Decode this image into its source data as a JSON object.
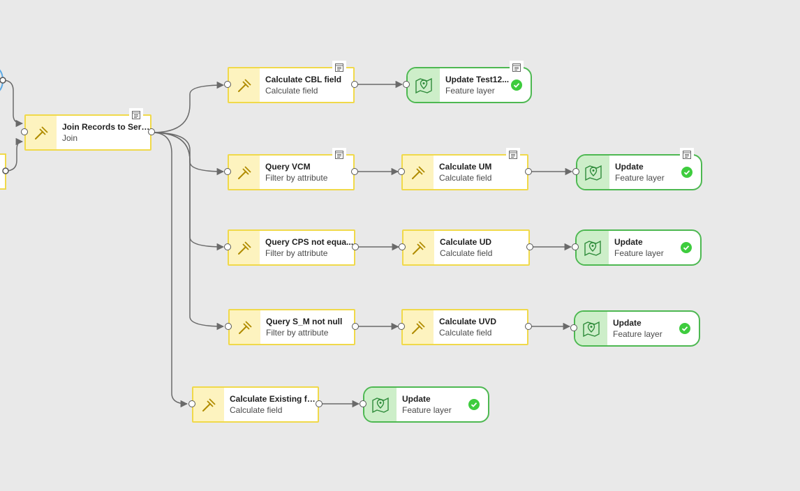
{
  "canvas": {
    "background": "#e9e9e9",
    "edge_color": "#6a6a6a"
  },
  "colors": {
    "tool_border": "#f0d94a",
    "tool_icon_bg": "#fdf3bf",
    "output_border": "#4db851",
    "output_icon_bg": "#cdeec9",
    "success": "#3ecc3e"
  },
  "nodes": {
    "join": {
      "title": "Join Records to Servi...",
      "subtitle": "Join",
      "icon": "hammer-icon",
      "has_note": true
    },
    "calc_cbl": {
      "title": "Calculate CBL field",
      "subtitle": "Calculate field",
      "icon": "hammer-icon",
      "has_note": true
    },
    "update_test": {
      "title": "Update Test12...",
      "subtitle": "Feature layer",
      "icon": "map-pin-icon",
      "has_note": true,
      "status": "success"
    },
    "query_vcm": {
      "title": "Query VCM",
      "subtitle": "Filter by attribute",
      "icon": "hammer-icon",
      "has_note": true
    },
    "calc_um": {
      "title": "Calculate UM",
      "subtitle": "Calculate field",
      "icon": "hammer-icon",
      "has_note": true
    },
    "update_um": {
      "title": "Update",
      "subtitle": "Feature layer",
      "icon": "map-pin-icon",
      "has_note": true,
      "status": "success"
    },
    "query_cps": {
      "title": "Query CPS  not equa...",
      "subtitle": "Filter by attribute",
      "icon": "hammer-icon",
      "has_note": false
    },
    "calc_ud": {
      "title": "Calculate UD",
      "subtitle": "Calculate field",
      "icon": "hammer-icon",
      "has_note": false
    },
    "update_ud": {
      "title": "Update",
      "subtitle": "Feature layer",
      "icon": "map-pin-icon",
      "has_note": false,
      "status": "success"
    },
    "query_sm": {
      "title": "Query S_M not null",
      "subtitle": "Filter by attribute",
      "icon": "hammer-icon",
      "has_note": false
    },
    "calc_uvd": {
      "title": "Calculate UVD",
      "subtitle": "Calculate field",
      "icon": "hammer-icon",
      "has_note": false
    },
    "update_uvd": {
      "title": "Update",
      "subtitle": "Feature layer",
      "icon": "map-pin-icon",
      "has_note": false,
      "status": "success"
    },
    "calc_existing": {
      "title": "Calculate Existing fie...",
      "subtitle": "Calculate field",
      "icon": "hammer-icon",
      "has_note": false
    },
    "update_existing": {
      "title": "Update",
      "subtitle": "Feature layer",
      "icon": "map-pin-icon",
      "has_note": false,
      "status": "success"
    }
  }
}
